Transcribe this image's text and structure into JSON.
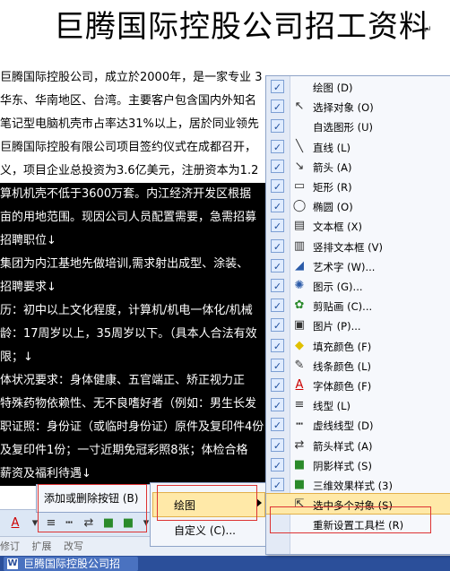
{
  "document": {
    "title": "巨腾国际控股公司招工资料",
    "lines": [
      {
        "text": "巨腾国际控股公司，成立於2000年，是一家专业 3",
        "selected": false
      },
      {
        "text": "华东、华南地区、台湾。主要客户包含国内外知名",
        "selected": false
      },
      {
        "text": "笔记型电脑机壳市占率达31%以上，居於同业领先",
        "selected": false
      },
      {
        "text": "巨腾国际控股有限公司项目签约仪式在成都召开，",
        "selected": false
      },
      {
        "text": "义，项目企业总投资为3.6亿美元，注册资本为1.2",
        "selected": false
      },
      {
        "text": "算机机壳不低于3600万套。内江经济开发区根据",
        "selected": true
      },
      {
        "text": "亩的用地范围。现因公司人员配置需要，急需招募",
        "selected": true
      },
      {
        "text": "招聘职位↓",
        "selected": true
      },
      {
        "text": "集团为内江基地先做培训,需求射出成型、涂装、",
        "selected": true
      },
      {
        "text": "招聘要求↓",
        "selected": true
      },
      {
        "text": "历：初中以上文化程度，计算机/机电一体化/机械",
        "selected": true
      },
      {
        "text": "龄：17周岁以上，35周岁以下。（具本人合法有效",
        "selected": true
      },
      {
        "text": "限；↓",
        "selected": true
      },
      {
        "text": "体状况要求：身体健康、五官端正、矫正视力正",
        "selected": true
      },
      {
        "text": "特殊药物依赖性、无不良嗜好者（例如：男生长发",
        "selected": true
      },
      {
        "text": "职证照：身份证（或临时身份证）原件及复印件4份",
        "selected": true
      },
      {
        "text": "及复印件1份；一寸近期免冠彩照8张；体检合格",
        "selected": true
      },
      {
        "text": "薪资及福利待遇↓",
        "selected": true
      }
    ]
  },
  "context_menu": {
    "add_remove_buttons": "添加或删除按钮 (B)",
    "submenu_draw": "绘图",
    "customize": "自定义 (C)...",
    "items": [
      {
        "label": "绘图 (D)",
        "icon": "blank-icon",
        "checked": true
      },
      {
        "label": "选择对象 (O)",
        "icon": "pointer-icon",
        "checked": true
      },
      {
        "label": "自选图形 (U)",
        "icon": "blank-icon",
        "checked": true
      },
      {
        "label": "直线 (L)",
        "icon": "line-icon",
        "checked": true
      },
      {
        "label": "箭头 (A)",
        "icon": "arrow-icon",
        "checked": true
      },
      {
        "label": "矩形 (R)",
        "icon": "rectangle-icon",
        "checked": true
      },
      {
        "label": "椭圆 (O)",
        "icon": "ellipse-icon",
        "checked": true
      },
      {
        "label": "文本框 (X)",
        "icon": "textbox-icon",
        "checked": true
      },
      {
        "label": "竖排文本框 (V)",
        "icon": "vertical-textbox-icon",
        "checked": true
      },
      {
        "label": "艺术字 (W)...",
        "icon": "wordart-icon",
        "checked": true
      },
      {
        "label": "图示 (G)...",
        "icon": "diagram-icon",
        "checked": true
      },
      {
        "label": "剪贴画 (C)...",
        "icon": "clipart-icon",
        "checked": true
      },
      {
        "label": "图片 (P)...",
        "icon": "picture-icon",
        "checked": true
      },
      {
        "label": "填充颜色 (F)",
        "icon": "fill-color-icon",
        "checked": true
      },
      {
        "label": "线条颜色 (L)",
        "icon": "line-color-icon",
        "checked": true
      },
      {
        "label": "字体颜色 (F)",
        "icon": "font-color-icon",
        "checked": true
      },
      {
        "label": "线型 (L)",
        "icon": "line-style-icon",
        "checked": true
      },
      {
        "label": "虚线线型 (D)",
        "icon": "dash-style-icon",
        "checked": true
      },
      {
        "label": "箭头样式 (A)",
        "icon": "arrow-style-icon",
        "checked": true
      },
      {
        "label": "阴影样式 (S)",
        "icon": "shadow-style-icon",
        "checked": true
      },
      {
        "label": "三维效果样式 (3)",
        "icon": "3d-style-icon",
        "checked": true
      },
      {
        "label": "选中多个对象 (S)",
        "icon": "select-multiple-icon",
        "checked": false,
        "highlighted": true
      },
      {
        "label": "重新设置工具栏 (R)",
        "icon": "blank-icon",
        "checked": false
      }
    ]
  },
  "statusbar": {
    "items": [
      "修订",
      "扩展",
      "改写"
    ]
  },
  "taskbar": {
    "doc_button": "巨腾国际控股公司招"
  }
}
